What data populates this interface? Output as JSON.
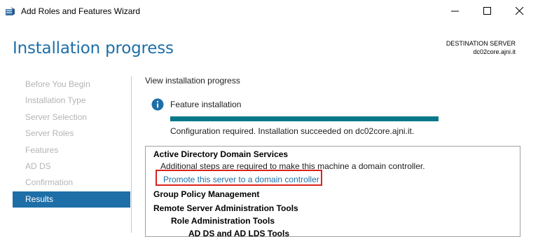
{
  "window": {
    "title": "Add Roles and Features Wizard",
    "controls": {
      "minimize_icon": "minimize-icon",
      "maximize_icon": "maximize-icon",
      "close_icon": "close-icon"
    }
  },
  "header": {
    "page_title": "Installation progress",
    "destination_label": "DESTINATION SERVER",
    "destination_server": "dc02core.ajni.it"
  },
  "nav": {
    "items": [
      {
        "label": "Before You Begin",
        "active": false
      },
      {
        "label": "Installation Type",
        "active": false
      },
      {
        "label": "Server Selection",
        "active": false
      },
      {
        "label": "Server Roles",
        "active": false
      },
      {
        "label": "Features",
        "active": false
      },
      {
        "label": "AD DS",
        "active": false
      },
      {
        "label": "Confirmation",
        "active": false
      },
      {
        "label": "Results",
        "active": true
      }
    ]
  },
  "main": {
    "heading": "View installation progress",
    "feature_label": "Feature installation",
    "progress": 1.0,
    "status": "Configuration required. Installation succeeded on dc02core.ajni.it.",
    "results": {
      "section1_title": "Active Directory Domain Services",
      "section1_desc": "Additional steps are required to make this machine a domain controller.",
      "promote_link": "Promote this server to a domain controller",
      "section2_title": "Group Policy Management",
      "section3_title": "Remote Server Administration Tools",
      "sub1_title": "Role Administration Tools",
      "sub2_title": "AD DS and AD LDS Tools"
    }
  },
  "colors": {
    "accent": "#1e6fa8",
    "progress": "#06788a",
    "highlight_border": "#d9231f"
  }
}
